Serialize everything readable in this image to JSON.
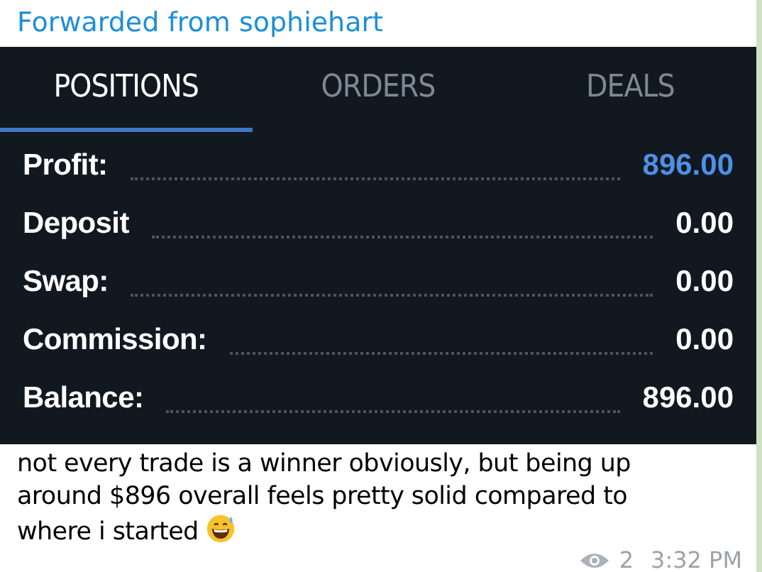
{
  "forwarded_from": "Forwarded from sophiehart",
  "tabs": [
    {
      "label": "POSITIONS",
      "selected": true
    },
    {
      "label": "ORDERS",
      "selected": false
    },
    {
      "label": "DEALS",
      "selected": false
    }
  ],
  "summary": [
    {
      "label": "Profit:",
      "value": "896.00",
      "highlighted": true
    },
    {
      "label": "Deposit",
      "value": "0.00",
      "highlighted": false
    },
    {
      "label": "Swap:",
      "value": "0.00",
      "highlighted": false
    },
    {
      "label": "Commission:",
      "value": "0.00",
      "highlighted": false
    },
    {
      "label": "Balance:",
      "value": "896.00",
      "highlighted": false
    }
  ],
  "message": "not every trade is a winner obviously, but being up around $896 overall feels pretty solid compared to where i started",
  "views": "2",
  "time": "3:32 PM"
}
